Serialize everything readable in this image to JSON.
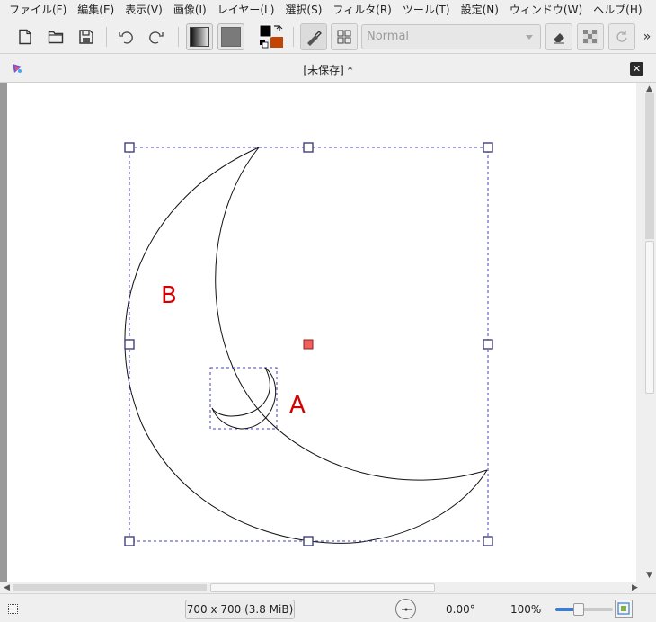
{
  "menubar": {
    "items": [
      "ファイル(F)",
      "編集(E)",
      "表示(V)",
      "画像(I)",
      "レイヤー(L)",
      "選択(S)",
      "フィルタ(R)",
      "ツール(T)",
      "設定(N)",
      "ウィンドウ(W)",
      "ヘルプ(H)"
    ]
  },
  "toolbar": {
    "blend_mode": "Normal",
    "overflow": "»",
    "fg_color": "#000000",
    "bg_color": "#c24400"
  },
  "document": {
    "title": "[未保存] *"
  },
  "canvas": {
    "label_a": "A",
    "label_b": "B",
    "label_color": "#d40000",
    "selection_color": "#4040c0"
  },
  "statusbar": {
    "image_size": "700 x 700 (3.8 MiB)",
    "rotation": "0.00°",
    "zoom": "100%",
    "zoom_level": 0.4
  }
}
